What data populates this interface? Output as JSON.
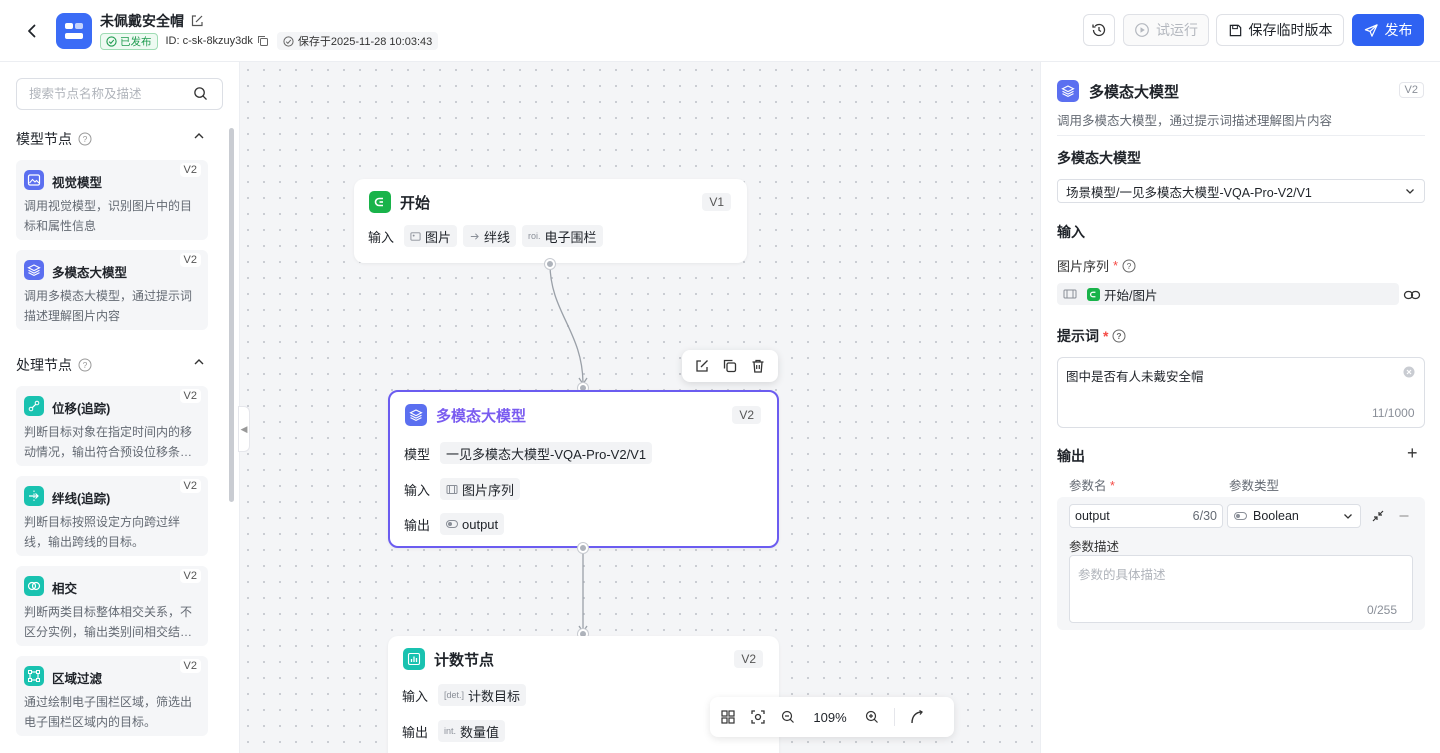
{
  "header": {
    "title": "未佩戴安全帽",
    "status": "已发布",
    "id_text": "ID: c-sk-8kzuy3dk",
    "saved_text": "保存于2025-11-28 10:03:43",
    "buttons": {
      "test_run": "试运行",
      "save_temp": "保存临时版本",
      "publish": "发布"
    }
  },
  "colors": {
    "primary": "#2f62f2",
    "node_selected": "#6b5cf0",
    "success": "#1f9b4f",
    "start_green": "#19b34a",
    "teal": "#19c2b0",
    "required": "#f54a45"
  },
  "sidebar": {
    "search_placeholder": "搜索节点名称及描述",
    "sections": [
      {
        "title": "模型节点",
        "items": [
          {
            "name": "视觉模型",
            "version": "V2",
            "desc": "调用视觉模型，识别图片中的目标和属性信息",
            "icon": "image-icon"
          },
          {
            "name": "多模态大模型",
            "version": "V2",
            "desc": "调用多模态大模型，通过提示词描述理解图片内容",
            "icon": "layers-icon"
          }
        ]
      },
      {
        "title": "处理节点",
        "items": [
          {
            "name": "位移(追踪)",
            "version": "V2",
            "desc": "判断目标对象在指定时间内的移动情况，输出符合预设位移条件的目标。",
            "icon": "displacement-icon"
          },
          {
            "name": "绊线(追踪)",
            "version": "V2",
            "desc": "判断目标按照设定方向跨过绊线，输出跨线的目标。",
            "icon": "tripwire-icon"
          },
          {
            "name": "相交",
            "version": "V2",
            "desc": "判断两类目标整体相交关系，不区分实例，输出类别间相交结果。",
            "icon": "intersect-icon"
          },
          {
            "name": "区域过滤",
            "version": "V2",
            "desc": "通过绘制电子围栏区域，筛选出电子围栏区域内的目标。",
            "icon": "region-icon"
          }
        ]
      }
    ]
  },
  "canvas": {
    "nodes": {
      "start": {
        "title": "开始",
        "version": "V1",
        "input_label": "输入",
        "inputs": [
          {
            "tag": "",
            "label": "图片"
          },
          {
            "tag": "",
            "label": "绊线"
          },
          {
            "tag": "roi.",
            "label": "电子围栏"
          }
        ]
      },
      "mllm": {
        "title": "多模态大模型",
        "version": "V2",
        "model_label": "模型",
        "model_value": "一见多模态大模型-VQA-Pro-V2/V1",
        "input_label": "输入",
        "input_value": "图片序列",
        "output_label": "输出",
        "output_value": "output"
      },
      "count": {
        "title": "计数节点",
        "version": "V2",
        "input_label": "输入",
        "input_tag": "[det.]",
        "input_value": "计数目标",
        "output_label": "输出",
        "output_tag": "int.",
        "output_value": "数量值"
      }
    },
    "zoom": "109%"
  },
  "panel": {
    "title": "多模态大模型",
    "version": "V2",
    "desc": "调用多模态大模型，通过提示词描述理解图片内容",
    "model_section": "多模态大模型",
    "model_value": "场景模型/一见多模态大模型-VQA-Pro-V2/V1",
    "input_section": "输入",
    "image_seq_label": "图片序列",
    "image_seq_value": "开始/图片",
    "prompt_label": "提示词",
    "prompt_value": "图中是否有人未戴安全帽",
    "prompt_count": "11/1000",
    "output_section": "输出",
    "param_name_col": "参数名",
    "param_type_col": "参数类型",
    "param_name_value": "output",
    "param_name_count": "6/30",
    "param_type_value": "Boolean",
    "param_desc_label": "参数描述",
    "param_desc_placeholder": "参数的具体描述",
    "param_desc_count": "0/255"
  }
}
